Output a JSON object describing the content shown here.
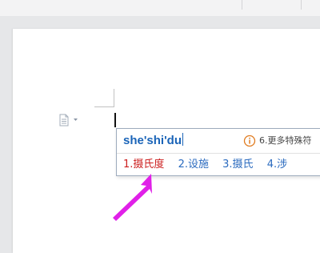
{
  "ime": {
    "composition": "she'shi'du",
    "hint_icon": "info-circle-icon",
    "hint": "6.更多特殊符",
    "candidates": [
      {
        "index": "1.",
        "text": "摄氏度"
      },
      {
        "index": "2.",
        "text": "设施"
      },
      {
        "index": "3.",
        "text": "摄氏"
      },
      {
        "index": "4.",
        "text": "涉"
      }
    ],
    "selected_index": 0
  },
  "icons": {
    "paste_options": "paste-options-icon",
    "annotation": "arrow-annotation"
  },
  "colors": {
    "composition_text": "#1a64b8",
    "candidate_text": "#2b6bbf",
    "selected_candidate": "#cc1e1e",
    "hint_icon": "#e07b1f",
    "annotation_arrow": "#e020e8",
    "page_background": "#ffffff",
    "workspace_background": "#e6e7e9"
  }
}
